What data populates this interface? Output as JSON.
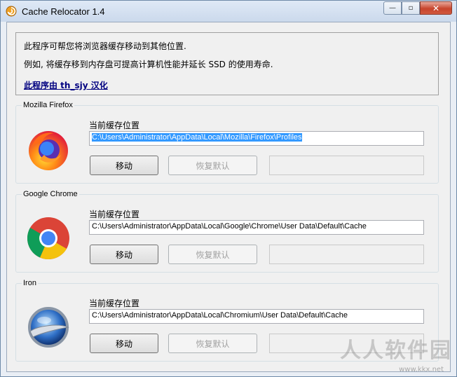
{
  "window": {
    "title": "Cache Relocator 1.4",
    "controls": {
      "minimize": "—",
      "maximize": "▫",
      "close": "✕"
    }
  },
  "intro": {
    "line1": "此程序可帮您将浏览器缓存移动到其他位置.",
    "line2": "例如, 将缓存移到内存盘可提高计算机性能并延长 SSD 的使用寿命.",
    "credit": "此程序由 th_sjy 汉化"
  },
  "browsers": [
    {
      "name": "Mozilla Firefox",
      "icon": "firefox-logo-icon",
      "current_label": "当前缓存位置",
      "path": "C:\\Users\\Administrator\\AppData\\Local\\Mozilla\\Firefox\\Profiles",
      "selected": true,
      "move_label": "移动",
      "restore_label": "恢复默认"
    },
    {
      "name": "Google Chrome",
      "icon": "chrome-logo-icon",
      "current_label": "当前缓存位置",
      "path": "C:\\Users\\Administrator\\AppData\\Local\\Google\\Chrome\\User Data\\Default\\Cache",
      "selected": false,
      "move_label": "移动",
      "restore_label": "恢复默认"
    },
    {
      "name": "Iron",
      "icon": "iron-logo-icon",
      "current_label": "当前缓存位置",
      "path": "C:\\Users\\Administrator\\AppData\\Local\\Chromium\\User Data\\Default\\Cache",
      "selected": false,
      "move_label": "移动",
      "restore_label": "恢复默认"
    }
  ],
  "watermark": {
    "text": "人人软件园",
    "sub": "www.kkx.net"
  },
  "colors": {
    "credit_link": "#000080",
    "selection": "#3399ff",
    "titlebar": "#cbd9ec"
  }
}
